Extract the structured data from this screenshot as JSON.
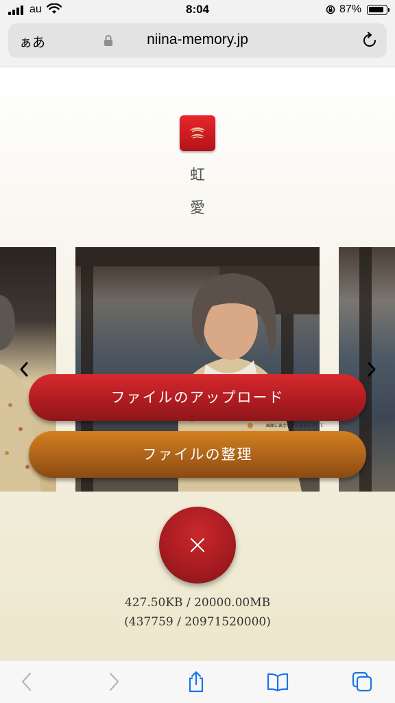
{
  "status_bar": {
    "carrier": "au",
    "time": "8:04",
    "battery_percent": "87%",
    "icons": [
      "signal-icon",
      "wifi-icon",
      "orientation-lock-icon",
      "battery-icon"
    ]
  },
  "address_bar": {
    "aa_label": "ぁあ",
    "url": "niina-memory.jp",
    "icons": [
      "lock-icon",
      "reload-icon"
    ]
  },
  "page": {
    "name_line_1": "虹",
    "name_line_2": "愛",
    "carousel_caption": "画面に表示ボタンをタップして",
    "upload_button": "ファイルのアップロード",
    "organize_button": "ファイルの整理",
    "usage_size": "427.50KB / 20000.00MB",
    "usage_bytes": "(437759 / 20971520000)"
  },
  "colors": {
    "upload_button": "#b31d22",
    "organize_button": "#b0651a",
    "close_button": "#a81c21",
    "logo": "#d21c22"
  },
  "toolbar": {
    "icons": [
      "back-icon",
      "forward-icon",
      "share-icon",
      "bookmarks-icon",
      "tabs-icon"
    ]
  }
}
